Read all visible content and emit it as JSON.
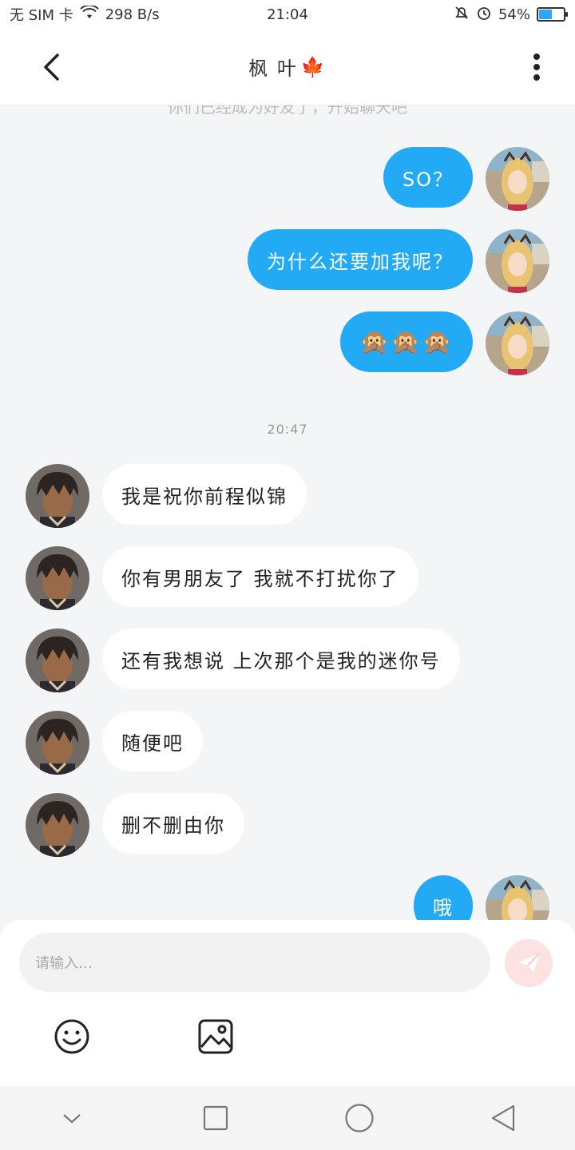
{
  "status": {
    "carrier": "无 SIM 卡",
    "speed": "298 B/s",
    "time": "21:04",
    "battery": "54%"
  },
  "header": {
    "title": "枫 叶",
    "title_emoji": "🍁"
  },
  "chat": {
    "faded_text": "你们已经成为好友了，开始聊天吧",
    "timestamp": "20:47",
    "messages": [
      {
        "side": "right",
        "text": "SO？"
      },
      {
        "side": "right",
        "text": "为什么还要加我呢？"
      },
      {
        "side": "right",
        "text": "🙊🙊🙊"
      },
      {
        "side": "left",
        "text": "我是祝你前程似锦"
      },
      {
        "side": "left",
        "text": "你有男朋友了 我就不打扰你了"
      },
      {
        "side": "left",
        "text": "还有我想说 上次那个是我的迷你号"
      },
      {
        "side": "left",
        "text": "随便吧"
      },
      {
        "side": "left",
        "text": "删不删由你"
      },
      {
        "side": "right",
        "text": "哦"
      }
    ]
  },
  "input": {
    "placeholder": "请输入…"
  },
  "icons": {
    "back": "chevron-left-icon",
    "more": "more-vertical-icon",
    "send": "send-icon",
    "emoji": "smiley-icon",
    "image": "image-icon",
    "nav_down": "chevron-down-icon",
    "nav_recent": "square-icon",
    "nav_home": "circle-icon",
    "nav_back": "triangle-back-icon"
  },
  "colors": {
    "accent": "#22aaf4",
    "chat_bg": "#f4f5f7",
    "send_btn": "#fde2e2"
  }
}
